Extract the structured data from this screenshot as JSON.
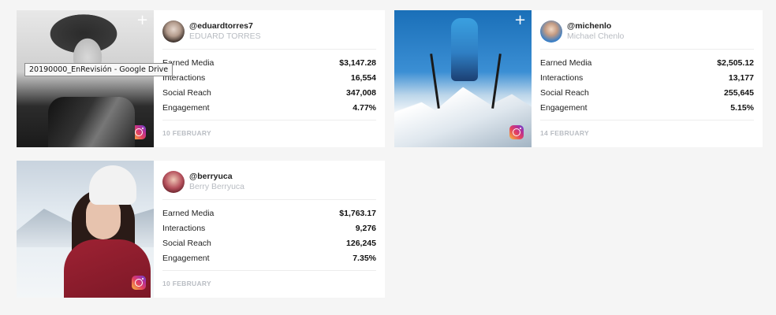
{
  "tooltip": {
    "text": "20190000_EnRevisión - Google Drive"
  },
  "cards": [
    {
      "handle": "@eduardtorres7",
      "name": "EDUARD TORRES",
      "stats": [
        {
          "label": "Earned Media",
          "value": "$3,147.28"
        },
        {
          "label": "Interactions",
          "value": "16,554"
        },
        {
          "label": "Social Reach",
          "value": "347,008"
        },
        {
          "label": "Engagement",
          "value": "4.77%"
        }
      ],
      "date": "10 FEBRUARY",
      "platform_icon": "instagram-icon",
      "action_icon": "plus-icon"
    },
    {
      "handle": "@michenlo",
      "name": "Michael Chenlo",
      "stats": [
        {
          "label": "Earned Media",
          "value": "$2,505.12"
        },
        {
          "label": "Interactions",
          "value": "13,177"
        },
        {
          "label": "Social Reach",
          "value": "255,645"
        },
        {
          "label": "Engagement",
          "value": "5.15%"
        }
      ],
      "date": "14 FEBRUARY",
      "platform_icon": "instagram-icon",
      "action_icon": "plus-icon"
    },
    {
      "handle": "@berryuca",
      "name": "Berry Berryuca",
      "stats": [
        {
          "label": "Earned Media",
          "value": "$1,763.17"
        },
        {
          "label": "Interactions",
          "value": "9,276"
        },
        {
          "label": "Social Reach",
          "value": "126,245"
        },
        {
          "label": "Engagement",
          "value": "7.35%"
        }
      ],
      "date": "10 FEBRUARY",
      "platform_icon": "instagram-icon"
    }
  ],
  "colors": {
    "background": "#f5f5f5",
    "card": "#ffffff",
    "muted_text": "#b8bcc2",
    "instagram_gradient": [
      "#f9c13a",
      "#e4405f",
      "#b0309e",
      "#5851db"
    ]
  }
}
